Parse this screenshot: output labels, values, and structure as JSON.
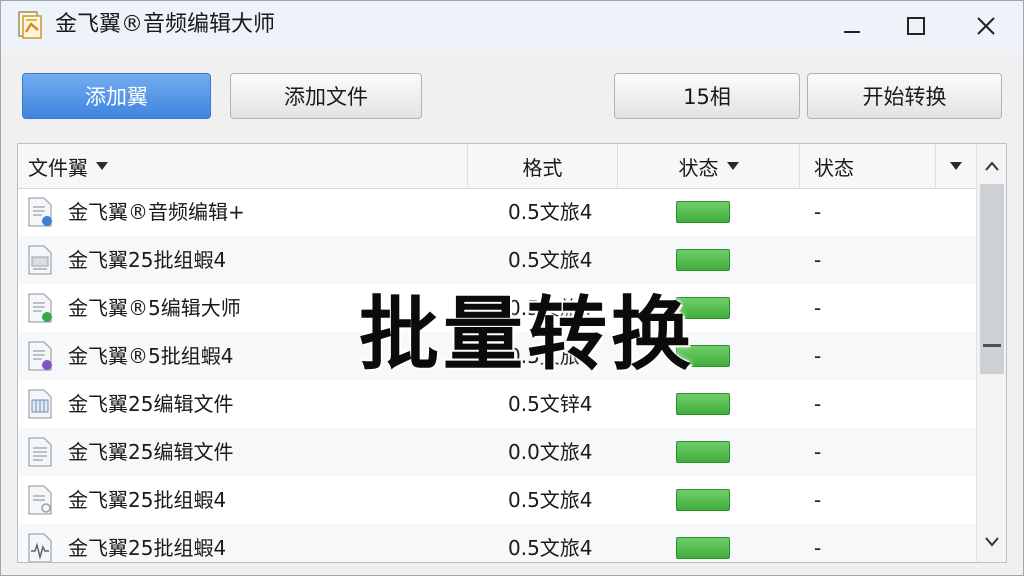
{
  "window": {
    "title": "金飞翼®音频编辑大师"
  },
  "toolbar": {
    "add_folder_label": "添加翼",
    "add_file_label": "添加文件",
    "count_label": "15相",
    "start_label": "开始转换"
  },
  "columns": {
    "name": "文件翼",
    "format": "格式",
    "progress": "状态",
    "status": "状态"
  },
  "rows": [
    {
      "name": "金飞翼®音频编辑+",
      "format": "0.5文旅4",
      "status": "-",
      "icon": "audio-file-icon"
    },
    {
      "name": "金飞翼25批组蝦4",
      "format": "0.5文旅4",
      "status": "-",
      "icon": "text-file-icon"
    },
    {
      "name": "金飞翼®5编辑大师",
      "format": "0.5文旅4",
      "status": "-",
      "icon": "audio-file-icon"
    },
    {
      "name": "金飞翼®5批组蝦4",
      "format": "0.5文旅4",
      "status": "-",
      "icon": "audio-file-icon"
    },
    {
      "name": "金飞翼25编辑文件",
      "format": "0.5文锌4",
      "status": "-",
      "icon": "spreadsheet-file-icon"
    },
    {
      "name": "金飞翼25编辑文件",
      "format": "0.0文旅4",
      "status": "-",
      "icon": "text-file-icon"
    },
    {
      "name": "金飞翼25批组蝦4",
      "format": "0.5文旅4",
      "status": "-",
      "icon": "document-file-icon"
    },
    {
      "name": "金飞翼25批组蝦4",
      "format": "0.5文旅4",
      "status": "-",
      "icon": "waveform-file-icon"
    }
  ],
  "overlay": {
    "text": "批量转换"
  },
  "colors": {
    "primary_button": "#4a8fe2",
    "progress_green": "#4cbf47"
  }
}
